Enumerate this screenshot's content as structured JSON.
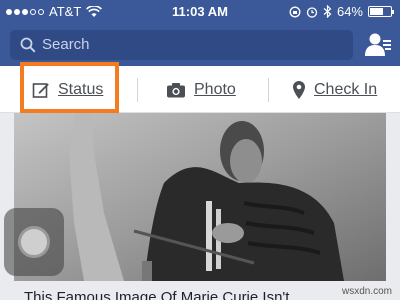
{
  "status_bar": {
    "carrier": "AT&T",
    "time": "11:03 AM",
    "battery": "64%",
    "battery_level": 0.64,
    "icons": [
      "signal-dots-icon",
      "wifi-icon",
      "rotation-lock-icon",
      "alarm-icon",
      "bluetooth-icon",
      "battery-icon"
    ]
  },
  "search": {
    "placeholder": "Search",
    "icon": "search-icon",
    "friends_icon": "friend-requests-icon"
  },
  "actions": [
    {
      "label": "Status",
      "icon": "edit-icon",
      "highlighted": true
    },
    {
      "label": "Photo",
      "icon": "camera-icon"
    },
    {
      "label": "Check In",
      "icon": "location-pin-icon"
    }
  ],
  "post": {
    "title": "This Famous Image Of Marie Curie Isn't"
  },
  "watermark": "wsxdn.com",
  "colors": {
    "header": "#3b5998",
    "search_bg": "#2f4a84",
    "highlight": "#f47b20",
    "action_text": "#4b4f56"
  }
}
